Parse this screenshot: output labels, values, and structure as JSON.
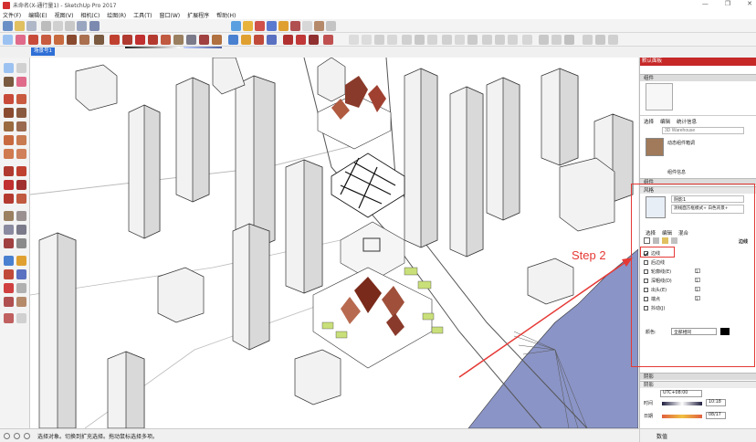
{
  "window": {
    "title": "未命名(X-通行量1) - SketchUp Pro 2017",
    "controls": [
      "—",
      "❐",
      "✕"
    ]
  },
  "menus": [
    "文件(F)",
    "编辑(E)",
    "视图(V)",
    "相机(C)",
    "绘图(R)",
    "工具(T)",
    "窗口(W)",
    "扩展程序",
    "帮助(H)"
  ],
  "shadow_slider": {
    "months": "1 2 3 4 5 6 7 8 9 10 11 12",
    "time": "08:32 ..."
  },
  "scene_tab": {
    "label": "场景号1"
  },
  "step_annotation": "Step 2",
  "tray": {
    "title": "默认面板",
    "entity_panel": {
      "header": "组件"
    },
    "components": {
      "tabs": [
        "选择",
        "编辑",
        "统计信息"
      ],
      "search_placeholder": "3D Warehouse",
      "item_label": "动态组件箱调"
    },
    "materials": {
      "header": "组件信息",
      "label": "组件"
    },
    "styles": {
      "header": "风格",
      "style_name": "阴影1",
      "style_desc": "测线面方框模式+ 白色背景+",
      "tabs": [
        "选择",
        "编辑",
        "混合"
      ],
      "section_label": "边线",
      "options": [
        {
          "label": "边线",
          "checked": true
        },
        {
          "label": "后边线",
          "checked": false
        },
        {
          "label": "轮廓线(E)",
          "checked": false,
          "value": "1"
        },
        {
          "label": "深粗线(D)",
          "checked": false,
          "value": "1"
        },
        {
          "label": "出头(E)",
          "checked": false,
          "value": "1"
        },
        {
          "label": "端点",
          "checked": false,
          "value": "1"
        },
        {
          "label": "抖动(J)",
          "checked": false
        }
      ],
      "color_label": "颜色:",
      "color_value": "全部相同"
    },
    "shadow_panel": {
      "header": "阴影",
      "sub_header": "阴影",
      "utc": "UTC+08:00",
      "time_label": "时间",
      "time_value": "10:18",
      "date_label": "日期",
      "date_value": "08/17"
    }
  },
  "status": {
    "message": "选择对象。切换到扩充选择。拖动鼠标选择多项。",
    "measure_label": "数值"
  },
  "colors": {
    "accent_red": "#e53935",
    "water": "#8a94c6",
    "tab_blue": "#2f6fd6"
  }
}
